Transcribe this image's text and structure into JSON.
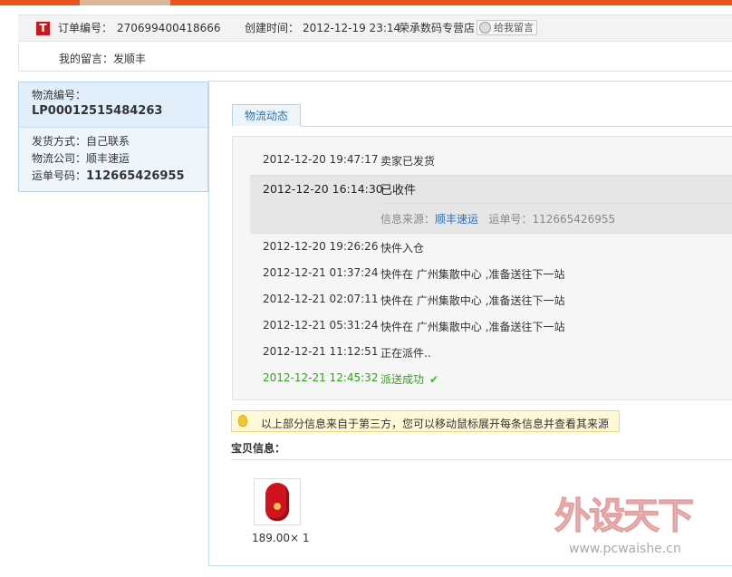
{
  "order": {
    "logo_text": "T",
    "number_label": "订单编号：",
    "number": "270699400418666",
    "created_label": "创建时间：",
    "created": "2012-12-19 23:14",
    "shop": "荣承数码专营店",
    "message_button": "给我留言",
    "remark_label": "我的留言：",
    "remark": "发顺丰"
  },
  "sidebar": {
    "logistics_no_label": "物流编号：",
    "logistics_no": "LP00012515484263",
    "ship_method_label": "发货方式：",
    "ship_method": "自己联系",
    "company_label": "物流公司：",
    "company": "顺丰速运",
    "waybill_label": "运单号码：",
    "waybill": "112665426955"
  },
  "tracking": {
    "tab": "物流动态",
    "events": [
      {
        "time": "2012-12-20 19:47:17",
        "desc": "卖家已发货"
      },
      {
        "time": "2012-12-20 16:14:30",
        "desc": "已收件",
        "source_label": "信息来源：",
        "source": "顺丰速运",
        "waybill_label": "运单号：",
        "waybill": "112665426955"
      },
      {
        "time": "2012-12-20 19:26:26",
        "desc": "快件入仓"
      },
      {
        "time": "2012-12-21 01:37:24",
        "desc": "快件在 广州集散中心 ,准备送往下一站"
      },
      {
        "time": "2012-12-21 02:07:11",
        "desc": "快件在 广州集散中心 ,准备送往下一站"
      },
      {
        "time": "2012-12-21 05:31:24",
        "desc": "快件在 广州集散中心 ,准备送往下一站"
      },
      {
        "time": "2012-12-21 11:12:51",
        "desc": "正在派件.."
      },
      {
        "time": "2012-12-21 12:45:32",
        "desc": "派送成功"
      }
    ],
    "notice": "以上部分信息来自于第三方，您可以移动鼠标展开每条信息并查看其来源"
  },
  "goods": {
    "title": "宝贝信息：",
    "price_qty": "189.00× 1"
  },
  "watermark": {
    "text": "外设天下",
    "url": "www.pcwaishe.cn"
  }
}
